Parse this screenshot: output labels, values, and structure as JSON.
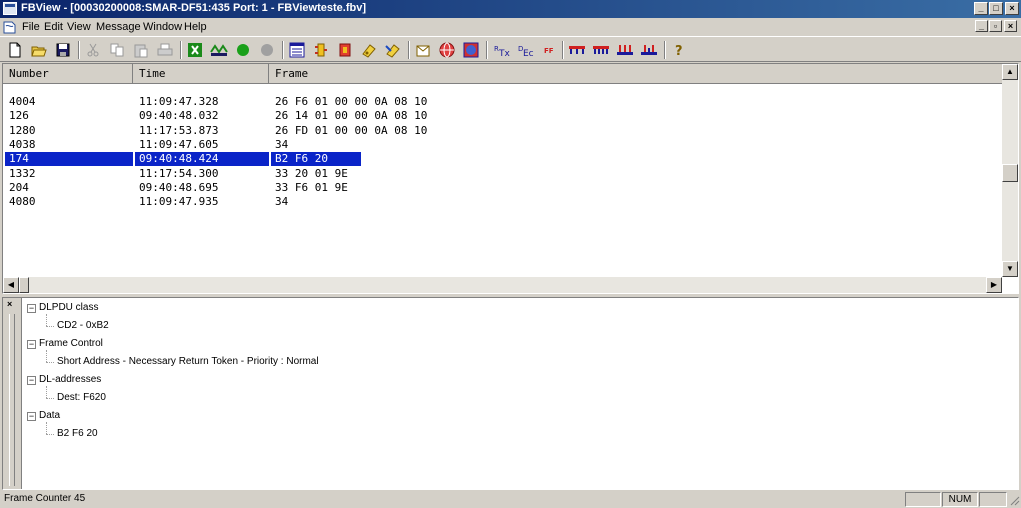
{
  "window": {
    "title": "FBView - [00030200008:SMAR-DF51:435 Port: 1 - FBViewteste.fbv]"
  },
  "menu": {
    "items": [
      "File",
      "Edit",
      "View",
      "Message",
      "Window",
      "Help"
    ]
  },
  "toolbar": {
    "icons": [
      "new-icon",
      "open-icon",
      "save-icon",
      "cut-icon",
      "copy-icon",
      "paste-icon",
      "print-icon",
      "start-capture-icon",
      "stop-capture-icon",
      "green-dot-icon",
      "gray-dot-icon",
      "frame-view-icon",
      "filter-icon",
      "filter-settings-icon",
      "trigger-icon",
      "trigger-settings-icon",
      "clipboard-icon",
      "globe-icon",
      "network-icon",
      "tx-icon",
      "rc-icon",
      "ff-icon",
      "bus-icon",
      "bus-alt-icon",
      "node-icon",
      "node-alt-icon",
      "help-icon"
    ]
  },
  "list": {
    "columns": [
      "Number",
      "Time",
      "Frame"
    ],
    "rows": [
      {
        "number": "4004",
        "time": "11:09:47.328",
        "frame": "26 F6 01 00 00 0A 08 10"
      },
      {
        "number": "126",
        "time": "09:40:48.032",
        "frame": "26 14 01 00 00 0A 08 10"
      },
      {
        "number": "1280",
        "time": "11:17:53.873",
        "frame": "26 FD 01 00 00 0A 08 10"
      },
      {
        "number": "4038",
        "time": "11:09:47.605",
        "frame": "34"
      },
      {
        "number": "174",
        "time": "09:40:48.424",
        "frame": "B2 F6 20",
        "selected": true
      },
      {
        "number": "1332",
        "time": "11:17:54.300",
        "frame": "33 20 01 9E"
      },
      {
        "number": "204",
        "time": "09:40:48.695",
        "frame": "33 F6 01 9E"
      },
      {
        "number": "4080",
        "time": "11:09:47.935",
        "frame": "34"
      }
    ]
  },
  "tree": {
    "nodes": [
      {
        "label": "DLPDU class",
        "child": "CD2 - 0xB2"
      },
      {
        "label": "Frame Control",
        "child": "Short Address - Necessary Return Token - Priority : Normal"
      },
      {
        "label": "DL-addresses",
        "child": "Dest: F620"
      },
      {
        "label": "Data",
        "child": "B2 F6 20"
      }
    ]
  },
  "status": {
    "text": "Frame Counter 45",
    "num": "NUM"
  },
  "colors": {
    "title_start": "#0a246a",
    "title_end": "#3a6ea5",
    "selection": "#0a24c8"
  }
}
